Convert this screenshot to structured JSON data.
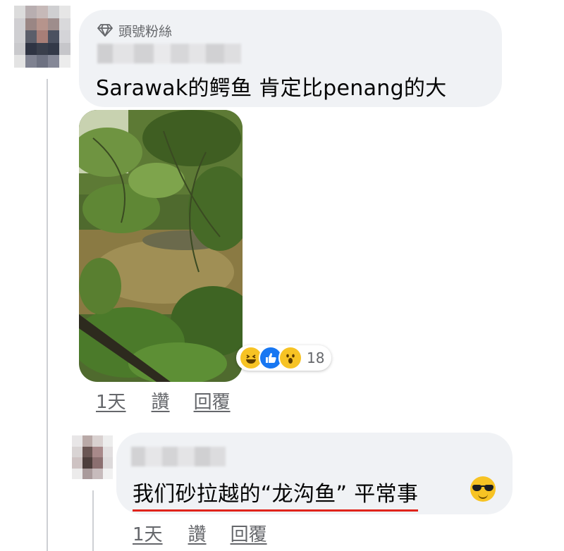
{
  "main_comment": {
    "badge_label": "頭號粉絲",
    "badge_icon": "diamond-icon",
    "text": "Sarawak的鳄鱼 肯定比penang的大",
    "photo_icon": "crocodile-jungle-photo",
    "reactions": {
      "icons": [
        "haha-reaction-icon",
        "like-reaction-icon",
        "wow-reaction-icon"
      ],
      "count": "18"
    },
    "actions": {
      "time": "1天",
      "like": "讚",
      "reply": "回覆"
    }
  },
  "reply_comment": {
    "text": "我们砂拉越的“龙沟鱼” 平常事",
    "emoji_icon": "sunglasses-emoji-icon",
    "actions": {
      "time": "1天",
      "like": "讚",
      "reply": "回覆"
    }
  },
  "colors": {
    "bubble": "#f0f2f5",
    "secondary_text": "#65676b",
    "underline_red": "#e0241b",
    "like_blue": "#1877f2"
  }
}
